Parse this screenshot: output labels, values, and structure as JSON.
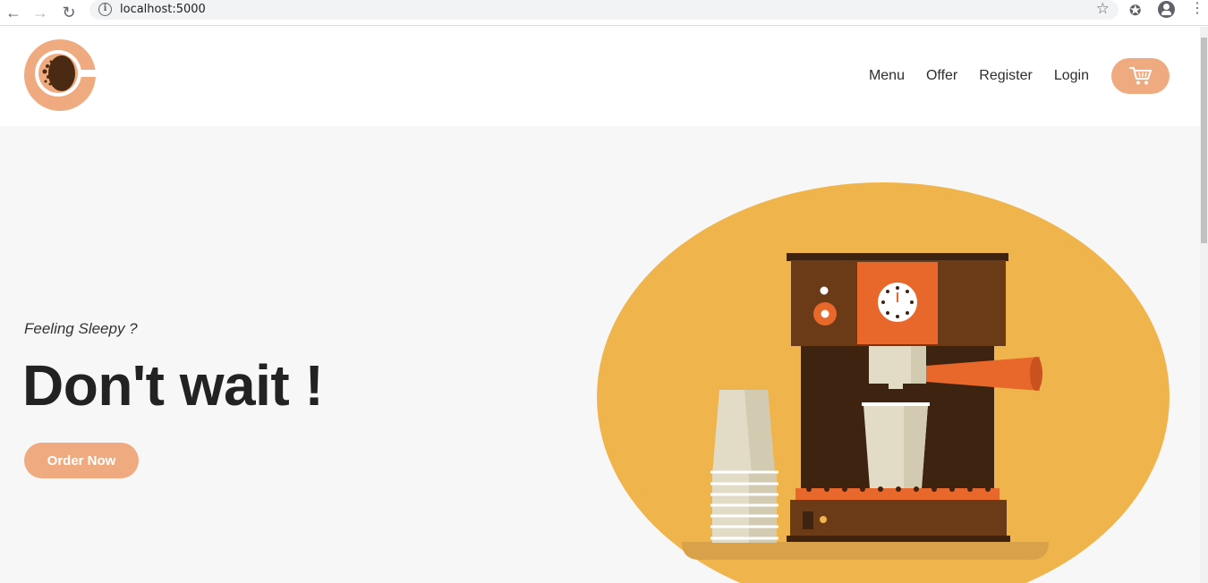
{
  "browser": {
    "url": "localhost:5000",
    "icons": [
      "back-arrow",
      "forward-arrow",
      "reload",
      "info",
      "star",
      "extensions",
      "profile",
      "menu-kebab"
    ]
  },
  "header": {
    "nav": [
      {
        "label": "Menu"
      },
      {
        "label": "Offer"
      },
      {
        "label": "Register"
      },
      {
        "label": "Login"
      }
    ],
    "cart_icon": "cart-icon"
  },
  "hero": {
    "tagline": "Feeling Sleepy ?",
    "headline": "Don't wait !",
    "cta_label": "Order Now"
  },
  "colors": {
    "accent": "#f0aa80",
    "hero_bg": "#f7f7f7",
    "circle": "#efb44b",
    "machine_dark": "#3e2410",
    "machine_brown": "#6b3b18",
    "machine_orange": "#e8672a"
  }
}
